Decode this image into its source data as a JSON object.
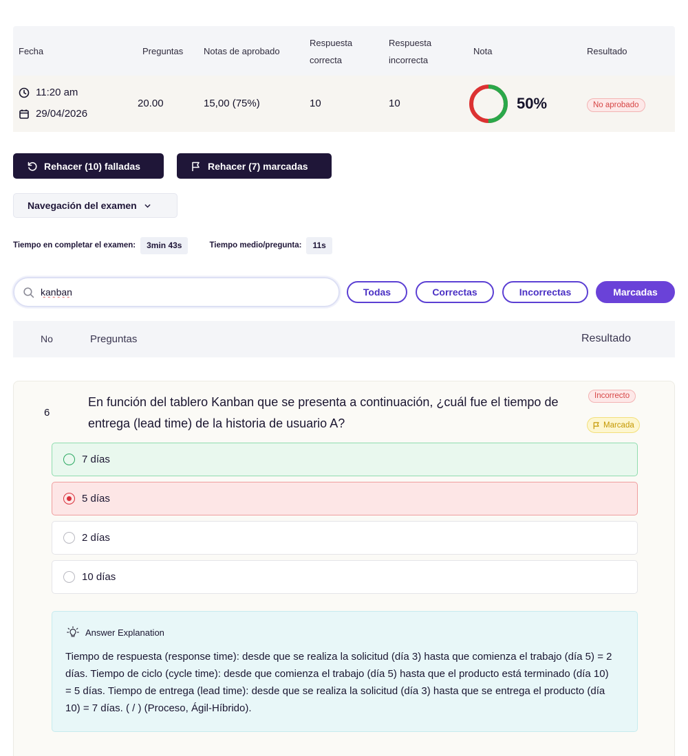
{
  "summary": {
    "headers": {
      "fecha": "Fecha",
      "preguntas": "Preguntas",
      "notas_aprobado": "Notas de aprobado",
      "resp_correcta": "Respuesta correcta",
      "resp_incorrecta": "Respuesta incorrecta",
      "nota": "Nota",
      "resultado": "Resultado"
    },
    "time": "11:20 am",
    "date": "29/04/2026",
    "preguntas": "20.00",
    "notas_aprobado": "15,00 (75%)",
    "correctas": "10",
    "incorrectas": "10",
    "nota": "50%",
    "nota_fraction": 0.5,
    "resultado": "No aprobado",
    "colors": {
      "correct": "#2aa84a",
      "incorrect": "#dc3232"
    }
  },
  "actions": {
    "rehacer_falladas": "Rehacer (10) falladas",
    "rehacer_marcadas": "Rehacer (7) marcadas",
    "navegacion": "Navegación del examen"
  },
  "timing": {
    "completar_label": "Tiempo en completar el examen:",
    "completar_value": "3min 43s",
    "medio_label": "Tiempo medio/pregunta:",
    "medio_value": "11s"
  },
  "search": {
    "value": "kanban"
  },
  "filters": {
    "todas": "Todas",
    "correctas": "Correctas",
    "incorrectas": "Incorrectas",
    "marcadas": "Marcadas",
    "active": "Marcadas"
  },
  "table_header": {
    "no": "No",
    "preguntas": "Preguntas",
    "resultado": "Resultado"
  },
  "question": {
    "number": "6",
    "text": "En función del tablero Kanban que se presenta a continuación, ¿cuál fue el tiempo de entrega (lead time) de la historia de usuario A?",
    "result_badge": "Incorrecto",
    "flag_badge": "Marcada",
    "options": [
      {
        "label": "7 días",
        "state": "correct"
      },
      {
        "label": "5 días",
        "state": "selected-wrong"
      },
      {
        "label": "2 días",
        "state": "none"
      },
      {
        "label": "10 días",
        "state": "none"
      }
    ],
    "explanation_title": "Answer Explanation",
    "explanation": "Tiempo de respuesta (response time): desde que se realiza la solicitud (día 3) hasta que comienza el trabajo (día 5) = 2 días. Tiempo de ciclo (cycle time): desde que comienza el trabajo (día 5) hasta que el producto está terminado (día 10) = 5 días. Tiempo de entrega (lead time): desde que se realiza la solicitud (día 3) hasta que se entrega el producto (día 10) = 7 días. ( / ) (Proceso, Ágil-Híbrido)."
  },
  "icons": [
    "clock-icon",
    "calendar-icon",
    "undo-icon",
    "flag-icon",
    "chevron-down-icon",
    "search-icon",
    "lightbulb-icon"
  ]
}
